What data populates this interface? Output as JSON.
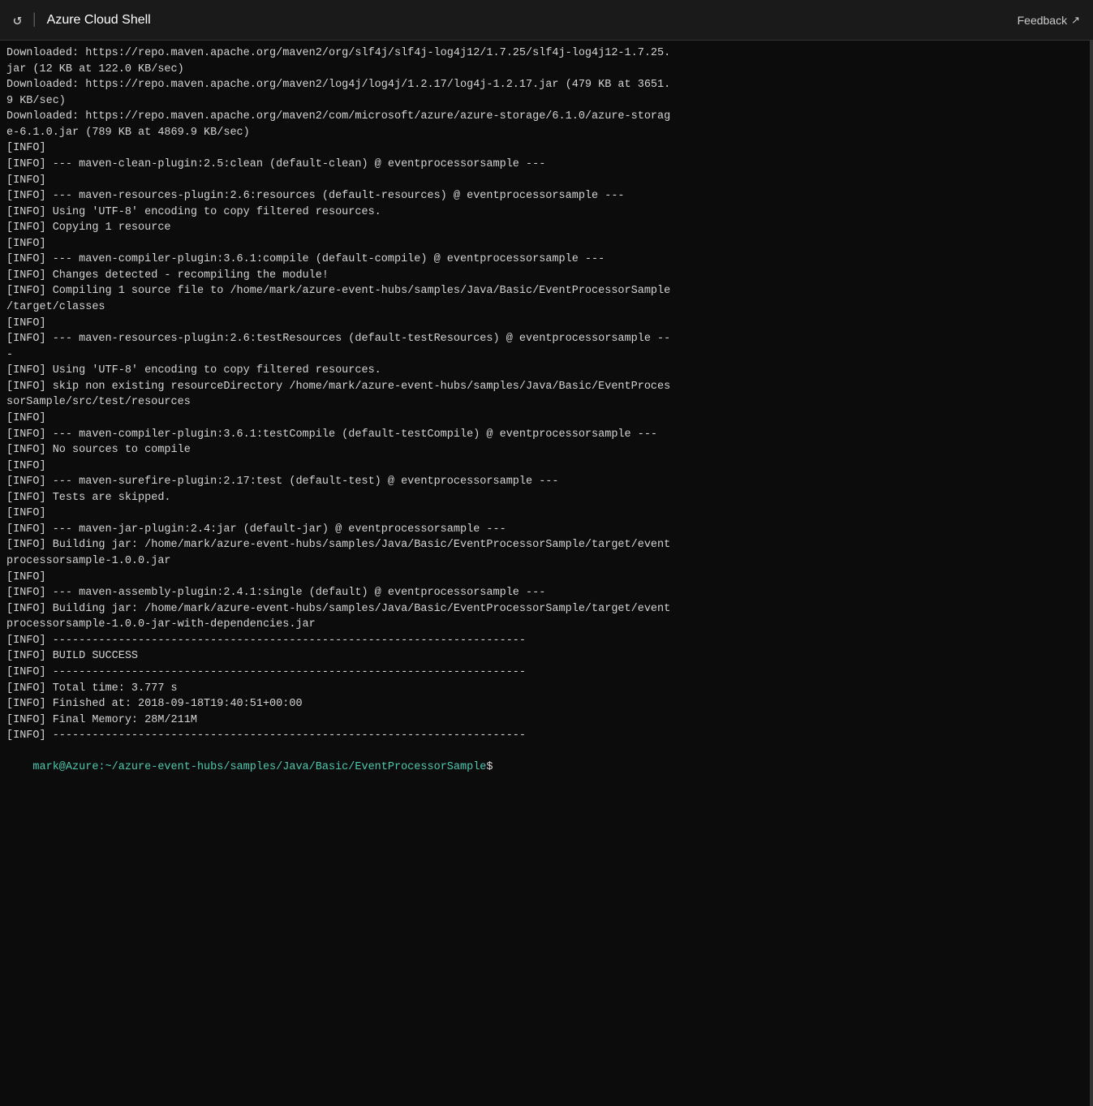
{
  "topbar": {
    "title": "Azure Cloud Shell",
    "feedback_label": "Feedback",
    "refresh_icon": "↺",
    "divider": "|",
    "external_link_icon": "↗"
  },
  "terminal": {
    "lines": [
      "Downloaded: https://repo.maven.apache.org/maven2/org/slf4j/slf4j-log4j12/1.7.25/slf4j-log4j12-1.7.25.",
      "jar (12 KB at 122.0 KB/sec)",
      "Downloaded: https://repo.maven.apache.org/maven2/log4j/log4j/1.2.17/log4j-1.2.17.jar (479 KB at 3651.",
      "9 KB/sec)",
      "Downloaded: https://repo.maven.apache.org/maven2/com/microsoft/azure/azure-storage/6.1.0/azure-storag",
      "e-6.1.0.jar (789 KB at 4869.9 KB/sec)",
      "[INFO]",
      "[INFO] --- maven-clean-plugin:2.5:clean (default-clean) @ eventprocessorsample ---",
      "[INFO]",
      "[INFO] --- maven-resources-plugin:2.6:resources (default-resources) @ eventprocessorsample ---",
      "[INFO] Using 'UTF-8' encoding to copy filtered resources.",
      "[INFO] Copying 1 resource",
      "[INFO]",
      "[INFO] --- maven-compiler-plugin:3.6.1:compile (default-compile) @ eventprocessorsample ---",
      "[INFO] Changes detected - recompiling the module!",
      "[INFO] Compiling 1 source file to /home/mark/azure-event-hubs/samples/Java/Basic/EventProcessorSample",
      "/target/classes",
      "[INFO]",
      "[INFO] --- maven-resources-plugin:2.6:testResources (default-testResources) @ eventprocessorsample --",
      "-",
      "[INFO] Using 'UTF-8' encoding to copy filtered resources.",
      "[INFO] skip non existing resourceDirectory /home/mark/azure-event-hubs/samples/Java/Basic/EventProces",
      "sorSample/src/test/resources",
      "[INFO]",
      "[INFO] --- maven-compiler-plugin:3.6.1:testCompile (default-testCompile) @ eventprocessorsample ---",
      "[INFO] No sources to compile",
      "[INFO]",
      "[INFO] --- maven-surefire-plugin:2.17:test (default-test) @ eventprocessorsample ---",
      "[INFO] Tests are skipped.",
      "[INFO]",
      "[INFO] --- maven-jar-plugin:2.4:jar (default-jar) @ eventprocessorsample ---",
      "[INFO] Building jar: /home/mark/azure-event-hubs/samples/Java/Basic/EventProcessorSample/target/event",
      "processorsample-1.0.0.jar",
      "[INFO]",
      "[INFO] --- maven-assembly-plugin:2.4.1:single (default) @ eventprocessorsample ---",
      "[INFO] Building jar: /home/mark/azure-event-hubs/samples/Java/Basic/EventProcessorSample/target/event",
      "processorsample-1.0.0-jar-with-dependencies.jar",
      "[INFO] ------------------------------------------------------------------------",
      "[INFO] BUILD SUCCESS",
      "[INFO] ------------------------------------------------------------------------",
      "[INFO] Total time: 3.777 s",
      "[INFO] Finished at: 2018-09-18T19:40:51+00:00",
      "[INFO] Final Memory: 28M/211M",
      "[INFO] ------------------------------------------------------------------------"
    ],
    "prompt_path": "mark@Azure:~/azure-event-hubs/samples/Java/Basic/EventProcessorSample",
    "prompt_symbol": "$"
  }
}
